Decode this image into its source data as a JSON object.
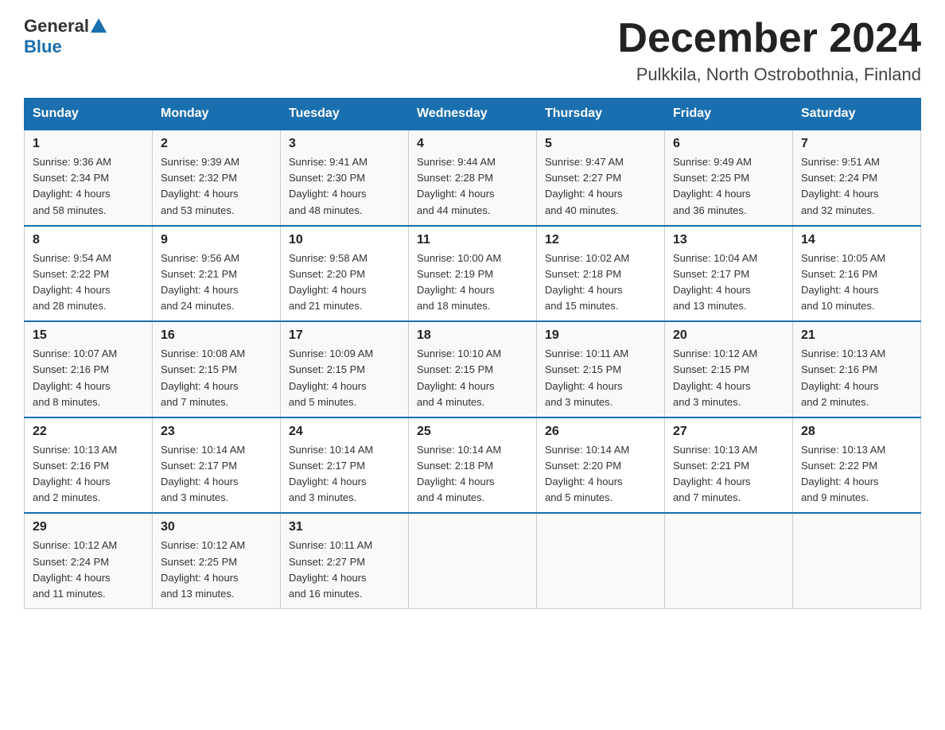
{
  "header": {
    "logo_general": "General",
    "logo_blue": "Blue",
    "title": "December 2024",
    "subtitle": "Pulkkila, North Ostrobothnia, Finland"
  },
  "columns": [
    "Sunday",
    "Monday",
    "Tuesday",
    "Wednesday",
    "Thursday",
    "Friday",
    "Saturday"
  ],
  "weeks": [
    [
      {
        "day": "1",
        "sunrise": "9:36 AM",
        "sunset": "2:34 PM",
        "daylight": "4 hours and 58 minutes."
      },
      {
        "day": "2",
        "sunrise": "9:39 AM",
        "sunset": "2:32 PM",
        "daylight": "4 hours and 53 minutes."
      },
      {
        "day": "3",
        "sunrise": "9:41 AM",
        "sunset": "2:30 PM",
        "daylight": "4 hours and 48 minutes."
      },
      {
        "day": "4",
        "sunrise": "9:44 AM",
        "sunset": "2:28 PM",
        "daylight": "4 hours and 44 minutes."
      },
      {
        "day": "5",
        "sunrise": "9:47 AM",
        "sunset": "2:27 PM",
        "daylight": "4 hours and 40 minutes."
      },
      {
        "day": "6",
        "sunrise": "9:49 AM",
        "sunset": "2:25 PM",
        "daylight": "4 hours and 36 minutes."
      },
      {
        "day": "7",
        "sunrise": "9:51 AM",
        "sunset": "2:24 PM",
        "daylight": "4 hours and 32 minutes."
      }
    ],
    [
      {
        "day": "8",
        "sunrise": "9:54 AM",
        "sunset": "2:22 PM",
        "daylight": "4 hours and 28 minutes."
      },
      {
        "day": "9",
        "sunrise": "9:56 AM",
        "sunset": "2:21 PM",
        "daylight": "4 hours and 24 minutes."
      },
      {
        "day": "10",
        "sunrise": "9:58 AM",
        "sunset": "2:20 PM",
        "daylight": "4 hours and 21 minutes."
      },
      {
        "day": "11",
        "sunrise": "10:00 AM",
        "sunset": "2:19 PM",
        "daylight": "4 hours and 18 minutes."
      },
      {
        "day": "12",
        "sunrise": "10:02 AM",
        "sunset": "2:18 PM",
        "daylight": "4 hours and 15 minutes."
      },
      {
        "day": "13",
        "sunrise": "10:04 AM",
        "sunset": "2:17 PM",
        "daylight": "4 hours and 13 minutes."
      },
      {
        "day": "14",
        "sunrise": "10:05 AM",
        "sunset": "2:16 PM",
        "daylight": "4 hours and 10 minutes."
      }
    ],
    [
      {
        "day": "15",
        "sunrise": "10:07 AM",
        "sunset": "2:16 PM",
        "daylight": "4 hours and 8 minutes."
      },
      {
        "day": "16",
        "sunrise": "10:08 AM",
        "sunset": "2:15 PM",
        "daylight": "4 hours and 7 minutes."
      },
      {
        "day": "17",
        "sunrise": "10:09 AM",
        "sunset": "2:15 PM",
        "daylight": "4 hours and 5 minutes."
      },
      {
        "day": "18",
        "sunrise": "10:10 AM",
        "sunset": "2:15 PM",
        "daylight": "4 hours and 4 minutes."
      },
      {
        "day": "19",
        "sunrise": "10:11 AM",
        "sunset": "2:15 PM",
        "daylight": "4 hours and 3 minutes."
      },
      {
        "day": "20",
        "sunrise": "10:12 AM",
        "sunset": "2:15 PM",
        "daylight": "4 hours and 3 minutes."
      },
      {
        "day": "21",
        "sunrise": "10:13 AM",
        "sunset": "2:16 PM",
        "daylight": "4 hours and 2 minutes."
      }
    ],
    [
      {
        "day": "22",
        "sunrise": "10:13 AM",
        "sunset": "2:16 PM",
        "daylight": "4 hours and 2 minutes."
      },
      {
        "day": "23",
        "sunrise": "10:14 AM",
        "sunset": "2:17 PM",
        "daylight": "4 hours and 3 minutes."
      },
      {
        "day": "24",
        "sunrise": "10:14 AM",
        "sunset": "2:17 PM",
        "daylight": "4 hours and 3 minutes."
      },
      {
        "day": "25",
        "sunrise": "10:14 AM",
        "sunset": "2:18 PM",
        "daylight": "4 hours and 4 minutes."
      },
      {
        "day": "26",
        "sunrise": "10:14 AM",
        "sunset": "2:20 PM",
        "daylight": "4 hours and 5 minutes."
      },
      {
        "day": "27",
        "sunrise": "10:13 AM",
        "sunset": "2:21 PM",
        "daylight": "4 hours and 7 minutes."
      },
      {
        "day": "28",
        "sunrise": "10:13 AM",
        "sunset": "2:22 PM",
        "daylight": "4 hours and 9 minutes."
      }
    ],
    [
      {
        "day": "29",
        "sunrise": "10:12 AM",
        "sunset": "2:24 PM",
        "daylight": "4 hours and 11 minutes."
      },
      {
        "day": "30",
        "sunrise": "10:12 AM",
        "sunset": "2:25 PM",
        "daylight": "4 hours and 13 minutes."
      },
      {
        "day": "31",
        "sunrise": "10:11 AM",
        "sunset": "2:27 PM",
        "daylight": "4 hours and 16 minutes."
      },
      null,
      null,
      null,
      null
    ]
  ],
  "labels": {
    "sunrise": "Sunrise:",
    "sunset": "Sunset:",
    "daylight": "Daylight:"
  }
}
